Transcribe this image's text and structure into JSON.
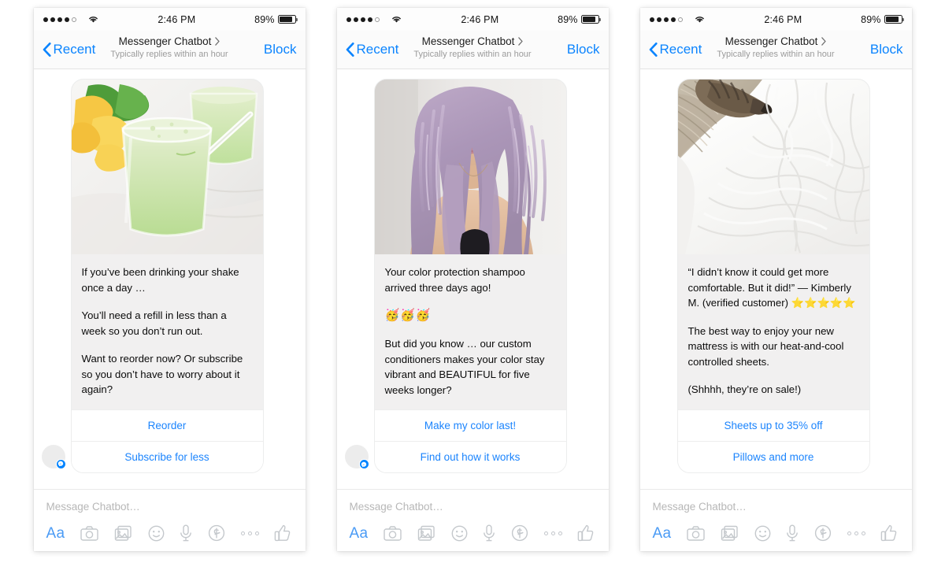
{
  "meta": {
    "theme_accent": "#0084ff",
    "bubble_bg": "#f1f0f0",
    "page_bg": "#ffffff"
  },
  "status_bar": {
    "signal_label": "••••◦",
    "signal_filled": 4,
    "signal_total": 5,
    "wifi": "wifi-icon",
    "time": "2:46 PM",
    "battery_percent": "89%",
    "battery_level": 89
  },
  "nav_bar": {
    "back_label": "Recent",
    "title": "Messenger Chatbot",
    "subtitle": "Typically replies within an hour",
    "action_label": "Block"
  },
  "composer": {
    "placeholder": "Message Chatbot…",
    "tools": [
      {
        "name": "text-format-tool",
        "label": "Aa"
      },
      {
        "name": "camera-tool",
        "label": "Camera"
      },
      {
        "name": "photo-gallery-tool",
        "label": "Photos"
      },
      {
        "name": "sticker-tool",
        "label": "Stickers"
      },
      {
        "name": "voice-tool",
        "label": "Voice"
      },
      {
        "name": "payment-tool",
        "label": "Payments"
      },
      {
        "name": "more-tool",
        "label": "More"
      },
      {
        "name": "thumbs-up-tool",
        "label": "Like"
      }
    ]
  },
  "panels": [
    {
      "id": "panel-shake",
      "has_avatar": true,
      "image": {
        "name": "green-smoothie-photo",
        "alt": "Green smoothie in a glass with a straw, lemons and spinach behind"
      },
      "paragraphs": [
        "If you’ve been drinking your shake once a day …",
        "You’ll need a refill in less than a week so you don’t run out.",
        "Want to reorder now? Or subscribe so you don’t have to worry about it again?"
      ],
      "emoji_line": "",
      "buttons": [
        {
          "name": "reorder-button",
          "label": "Reorder"
        },
        {
          "name": "subscribe-for-less-button",
          "label": "Subscribe for less"
        }
      ]
    },
    {
      "id": "panel-shampoo",
      "has_avatar": true,
      "image": {
        "name": "lavender-hair-photo",
        "alt": "Woman with long wavy lavender hair"
      },
      "paragraphs": [
        "Your color protection shampoo arrived three days ago!",
        "",
        "But did you know … our custom conditioners makes your color stay vibrant and BEAUTIFUL for five weeks longer?"
      ],
      "emoji_line": "🥳🥳🥳",
      "buttons": [
        {
          "name": "make-my-color-last-button",
          "label": "Make my color last!"
        },
        {
          "name": "find-out-how-it-works-button",
          "label": "Find out how it works"
        }
      ]
    },
    {
      "id": "panel-sheets",
      "has_avatar": false,
      "image": {
        "name": "white-bedsheets-photo",
        "alt": "Rumpled white bed sheets with a knit blanket and a cat"
      },
      "paragraphs": [
        "“I didn’t know it could get more comfortable. But it did!” — Kimberly M. (verified customer) ⭐⭐⭐⭐⭐",
        "The best way to enjoy your new mattress is with our heat-and-cool controlled sheets.",
        "(Shhhh, they’re on sale!)"
      ],
      "emoji_line": "",
      "buttons": [
        {
          "name": "sheets-discount-button",
          "label": "Sheets up to 35% off"
        },
        {
          "name": "pillows-and-more-button",
          "label": "Pillows and more"
        }
      ]
    }
  ]
}
